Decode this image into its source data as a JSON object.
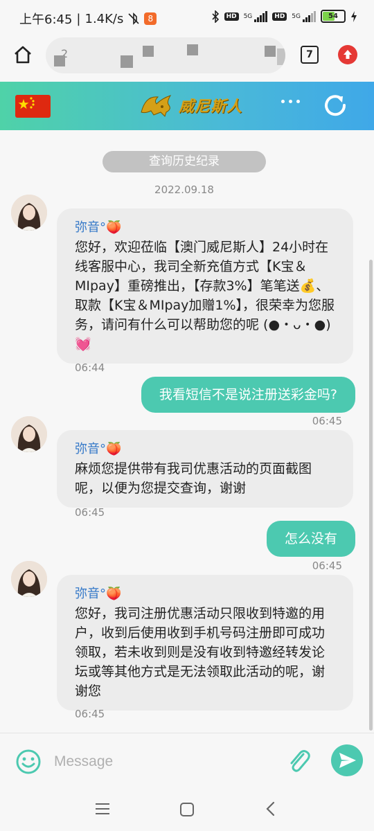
{
  "status_bar": {
    "time": "上午6:45",
    "net_speed": "1.4K/s",
    "sim1_label": "5G",
    "sim2_label": "5G",
    "hd_label": "HD",
    "battery": "54"
  },
  "browser": {
    "url": "2",
    "tab_count": "7"
  },
  "header": {
    "brand": "威尼斯人"
  },
  "chat": {
    "history_button": "查询历史纪录",
    "date": "2022.09.18",
    "messages": [
      {
        "sender": "弥音°🍑",
        "text": "您好，欢迎莅临【澳门威尼斯人】24小时在线客服中心，我司全新充值方式【K宝＆MIpay】重磅推出，【存款3%】笔笔送💰、取款【K宝＆MIpay加赠1%】，很荣幸为您服务，请问有什么可以帮助您的呢 (●・ᴗ・●)💓",
        "time": "06:44"
      },
      {
        "text": "我看短信不是说注册送彩金吗?",
        "time": "06:45"
      },
      {
        "sender": "弥音°🍑",
        "text": "麻烦您提供带有我司优惠活动的页面截图呢，以便为您提交查询，谢谢",
        "time": "06:45"
      },
      {
        "text": "怎么没有",
        "time": "06:45"
      },
      {
        "sender": "弥音°🍑",
        "text": "您好，我司注册优惠活动只限收到特邀的用户，收到后使用收到手机号码注册即可成功领取，若未收到则是没有收到特邀经转发论坛或等其他方式是无法领取此活动的呢，谢谢您",
        "time": "06:45"
      }
    ]
  },
  "composer": {
    "placeholder": "Message"
  },
  "colors": {
    "accent": "#4cc9b0",
    "header_gradient_start": "#4fd2a8",
    "header_gradient_end": "#3fa8e8",
    "agent_name": "#3478c8",
    "bubble_in": "#ececec"
  },
  "icons": {
    "home": "home-icon",
    "upgrade": "arrow-up-icon",
    "refresh": "refresh-icon",
    "more": "more-dots-icon",
    "emoji": "emoji-icon",
    "attach": "paperclip-icon",
    "send": "send-icon"
  }
}
